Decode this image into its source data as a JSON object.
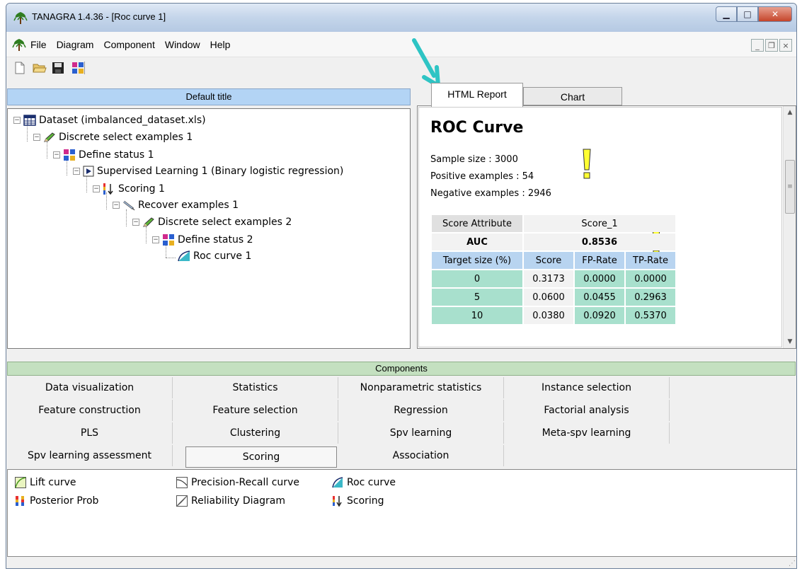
{
  "window": {
    "title": "TANAGRA 1.4.36 - [Roc curve 1]"
  },
  "menu": [
    "File",
    "Diagram",
    "Component",
    "Window",
    "Help"
  ],
  "diagram": {
    "title": "Default title",
    "nodes": [
      "Dataset (imbalanced_dataset.xls)",
      "Discrete select examples 1",
      "Define status 1",
      "Supervised Learning 1 (Binary logistic regression)",
      "Scoring 1",
      "Recover examples 1",
      "Discrete select examples 2",
      "Define status 2",
      "Roc curve 1"
    ]
  },
  "report": {
    "tabs": [
      "HTML Report",
      "Chart"
    ],
    "title": "ROC Curve",
    "sample_size_label": "Sample size :",
    "sample_size": "3000",
    "positive_label": "Positive examples :",
    "positive": "54",
    "negative_label": "Negative examples :",
    "negative": "2946",
    "table": {
      "score_attribute_label": "Score Attribute",
      "score_attribute_value": "Score_1",
      "auc_label": "AUC",
      "auc_value": "0.8536",
      "columns": [
        "Target size (%)",
        "Score",
        "FP-Rate",
        "TP-Rate"
      ],
      "rows": [
        [
          "0",
          "0.3173",
          "0.0000",
          "0.0000"
        ],
        [
          "5",
          "0.0600",
          "0.0455",
          "0.2963"
        ],
        [
          "10",
          "0.0380",
          "0.0920",
          "0.5370"
        ]
      ]
    }
  },
  "components": {
    "title": "Components",
    "categories": [
      [
        "Data visualization",
        "Statistics",
        "Nonparametric statistics",
        "Instance selection"
      ],
      [
        "Feature construction",
        "Feature selection",
        "Regression",
        "Factorial analysis"
      ],
      [
        "PLS",
        "Clustering",
        "Spv learning",
        "Meta-spv learning"
      ],
      [
        "Spv learning assessment",
        "Scoring",
        "Association",
        ""
      ]
    ],
    "selected": "Scoring",
    "items": [
      "Lift curve",
      "Precision-Recall curve",
      "Roc curve",
      "Posterior Prob",
      "Reliability Diagram",
      "Scoring"
    ]
  },
  "colors": {
    "diagram_header": "#b3d4f5",
    "components_header": "#c4e0c0",
    "table_blue": "#b8d4f0",
    "table_green": "#a8e0cd",
    "annotation_arrow": "#2ec4c4",
    "annotation_mark": "#ffff33"
  }
}
